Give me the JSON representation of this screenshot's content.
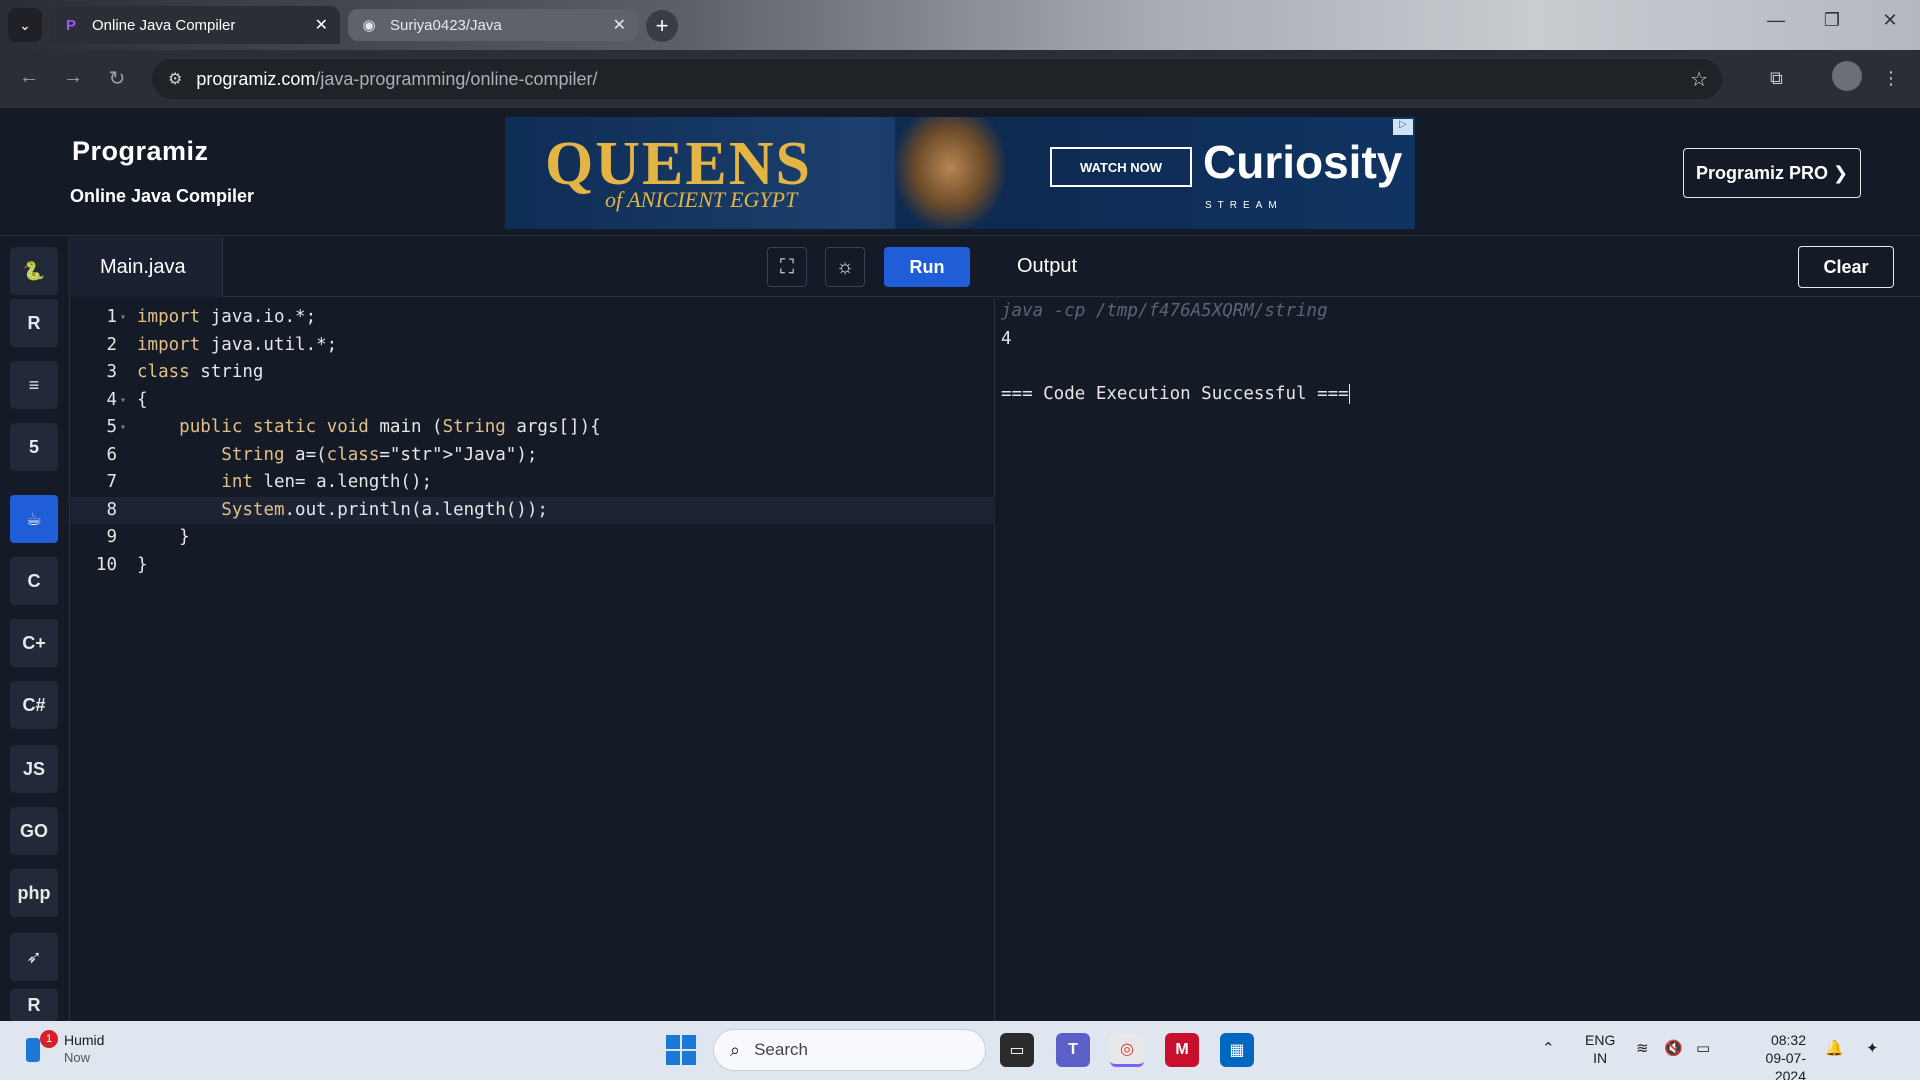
{
  "browser": {
    "tabs": [
      {
        "title": "Online Java Compiler",
        "active": true
      },
      {
        "title": "Suriya0423/Java",
        "active": false
      }
    ],
    "url_host": "programiz.com",
    "url_path": "/java-programming/online-compiler/"
  },
  "site": {
    "logo": "Programiz",
    "subtitle": "Online Java Compiler",
    "pro_button": "Programiz PRO ❯",
    "ad": {
      "headline": "QUEENS",
      "subline": "of ANICIENT EGYPT",
      "cta": "WATCH NOW",
      "brand": "Curiosity",
      "brand_sub": "STREAM"
    }
  },
  "sidebar": {
    "languages": [
      {
        "name": "python-icon",
        "glyph": "🐍"
      },
      {
        "name": "r-icon",
        "glyph": "R"
      },
      {
        "name": "sql-icon",
        "glyph": "≡"
      },
      {
        "name": "html5-icon",
        "glyph": "5"
      },
      {
        "name": "java-icon",
        "glyph": "☕",
        "active": true
      },
      {
        "name": "c-icon",
        "glyph": "C"
      },
      {
        "name": "cpp-icon",
        "glyph": "C+"
      },
      {
        "name": "csharp-icon",
        "glyph": "C#"
      },
      {
        "name": "javascript-icon",
        "glyph": "JS"
      },
      {
        "name": "go-icon",
        "glyph": "GO"
      },
      {
        "name": "php-icon",
        "glyph": "php"
      },
      {
        "name": "swift-icon",
        "glyph": "➶"
      },
      {
        "name": "rust-icon",
        "glyph": "R"
      }
    ]
  },
  "editor": {
    "file_name": "Main.java",
    "run_label": "Run",
    "lines": [
      {
        "n": "1",
        "fold": true,
        "text": "import java.io.*;"
      },
      {
        "n": "2",
        "fold": false,
        "text": "import java.util.*;"
      },
      {
        "n": "3",
        "fold": false,
        "text": "class string"
      },
      {
        "n": "4",
        "fold": true,
        "text": "{"
      },
      {
        "n": "5",
        "fold": true,
        "text": "    public static void main (String args[]){"
      },
      {
        "n": "6",
        "fold": false,
        "text": "        String a=(\"Java\");"
      },
      {
        "n": "7",
        "fold": false,
        "text": "        int len= a.length();"
      },
      {
        "n": "8",
        "fold": false,
        "text": "        System.out.println(a.length());",
        "highlight": true
      },
      {
        "n": "9",
        "fold": false,
        "text": "    }"
      },
      {
        "n": "10",
        "fold": false,
        "text": "}"
      }
    ]
  },
  "output": {
    "title": "Output",
    "clear_label": "Clear",
    "command": "java -cp /tmp/f476A5XQRM/string",
    "result": "4",
    "status": "=== Code Execution Successful ==="
  },
  "taskbar": {
    "weather_title": "Humid",
    "weather_sub": "Now",
    "weather_badge": "1",
    "search_placeholder": "Search",
    "lang_line1": "ENG",
    "lang_line2": "IN",
    "time": "08:32",
    "date": "09-07-2024"
  }
}
